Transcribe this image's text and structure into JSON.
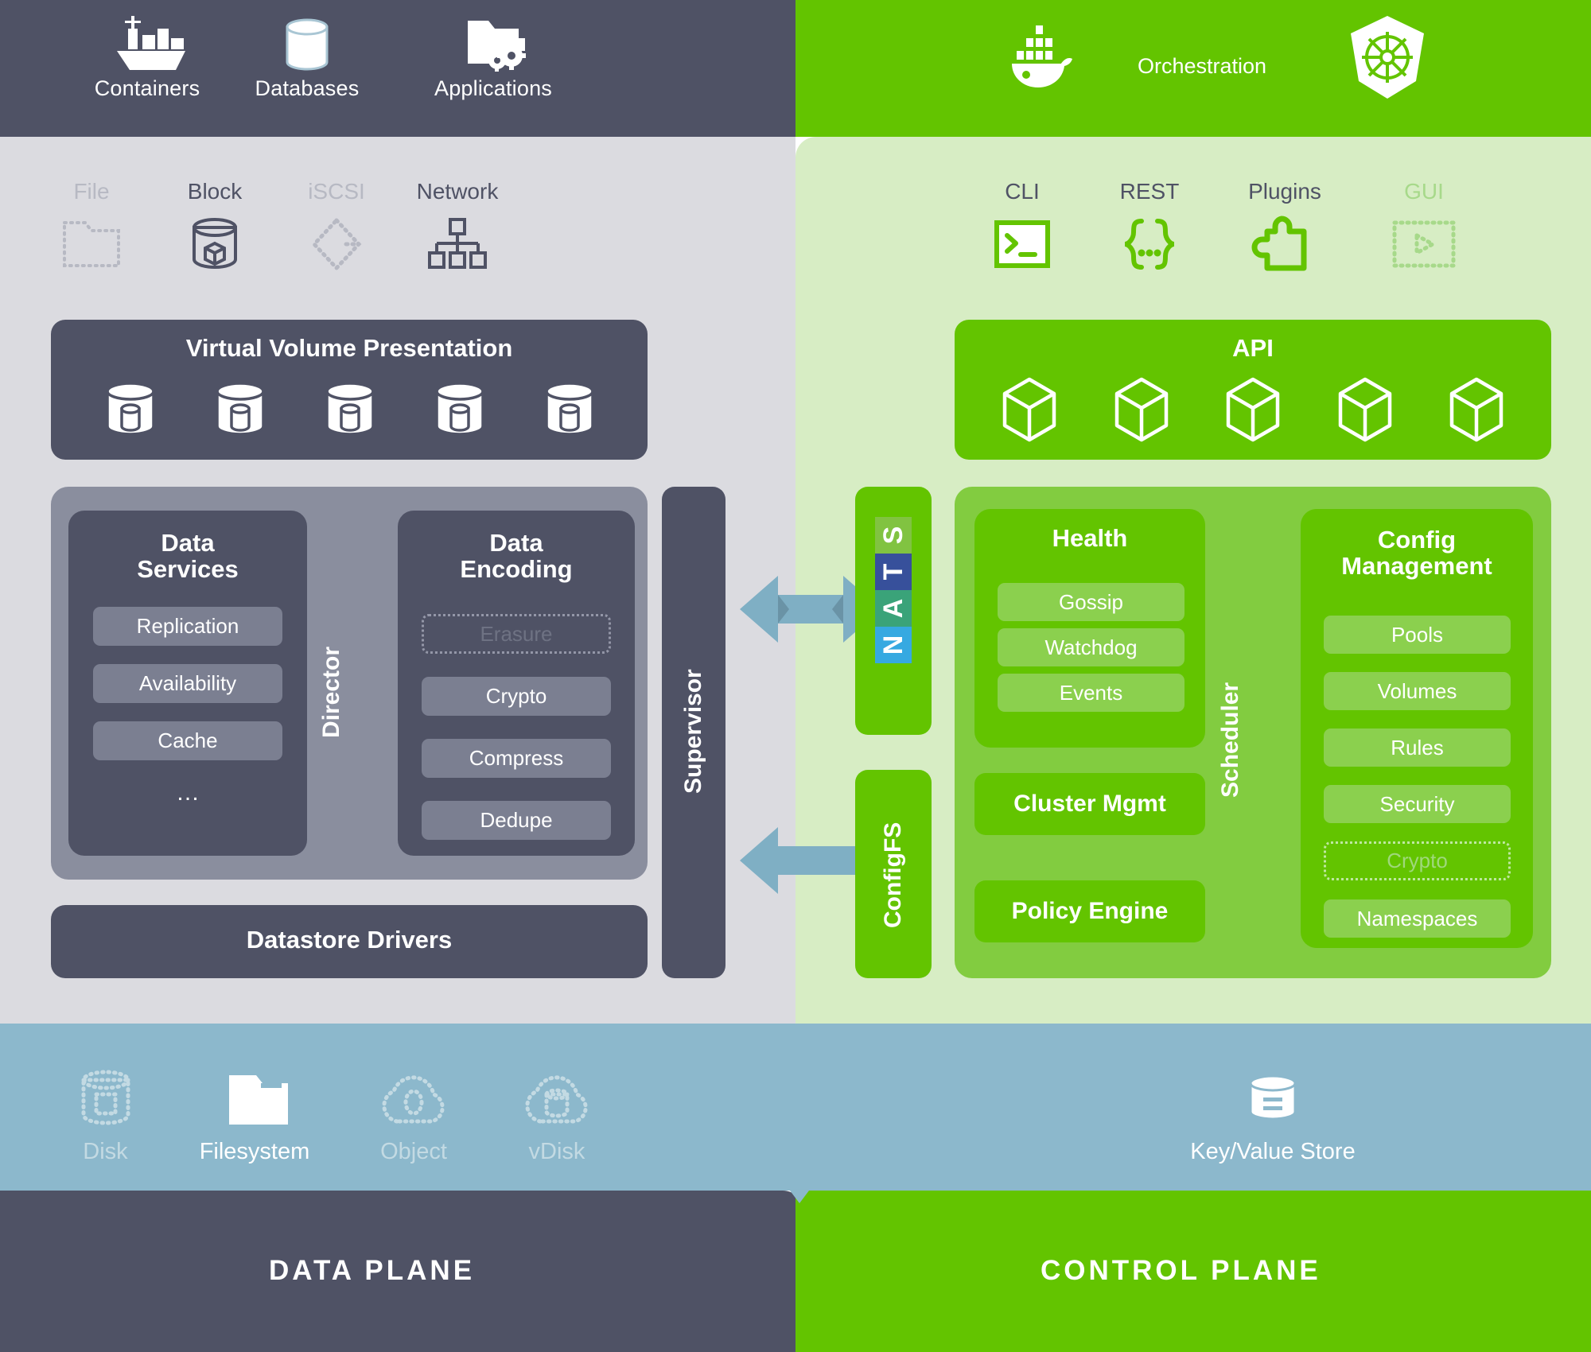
{
  "colors": {
    "data_plane_dark": "#4F5265",
    "control_plane_green": "#63C400",
    "data_plane_bg": "#DBDBE0",
    "control_plane_bg": "#D7EDC4",
    "storage_blue": "#8CB8CC",
    "arrow_blue": "#7FAFC4",
    "nats_s": "#81C341",
    "nats_t": "#37509B",
    "nats_a": "#3AA379",
    "nats_n": "#36A9E1"
  },
  "header": {
    "left_items": [
      {
        "label": "Containers",
        "icon": "container-ship-icon"
      },
      {
        "label": "Databases",
        "icon": "database-cylinder-icon"
      },
      {
        "label": "Applications",
        "icon": "folder-gears-icon"
      }
    ],
    "right_items": [
      {
        "icon": "docker-whale-icon"
      },
      {
        "label": "Orchestration"
      },
      {
        "icon": "kubernetes-helm-icon"
      }
    ]
  },
  "interfaces": {
    "data_plane": [
      {
        "label": "File",
        "icon": "folder-dotted-icon",
        "enabled": false
      },
      {
        "label": "Block",
        "icon": "block-cylinder-icon",
        "enabled": true
      },
      {
        "label": "iSCSI",
        "icon": "iscsi-diamond-icon",
        "enabled": false
      },
      {
        "label": "Network",
        "icon": "network-tree-icon",
        "enabled": true
      }
    ],
    "control_plane": [
      {
        "label": "CLI",
        "icon": "terminal-icon",
        "enabled": true
      },
      {
        "label": "REST",
        "icon": "braces-icon",
        "enabled": true
      },
      {
        "label": "Plugins",
        "icon": "puzzle-icon",
        "enabled": true
      },
      {
        "label": "GUI",
        "icon": "gui-play-icon",
        "enabled": false
      }
    ]
  },
  "virtual_volume": {
    "title": "Virtual Volume Presentation",
    "icon": "volume-cylinder-icon",
    "icon_count": 5
  },
  "api": {
    "title": "API",
    "icon": "cube-icon",
    "icon_count": 5
  },
  "director": {
    "vertical_label": "Director",
    "data_services": {
      "title": "Data\nServices",
      "title_line1": "Data",
      "title_line2": "Services",
      "items": [
        {
          "label": "Replication",
          "enabled": true
        },
        {
          "label": "Availability",
          "enabled": true
        },
        {
          "label": "Cache",
          "enabled": true
        }
      ],
      "ellipsis": "…"
    },
    "data_encoding": {
      "title_line1": "Data",
      "title_line2": "Encoding",
      "items": [
        {
          "label": "Erasure",
          "enabled": false
        },
        {
          "label": "Crypto",
          "enabled": true
        },
        {
          "label": "Compress",
          "enabled": true
        },
        {
          "label": "Dedupe",
          "enabled": true
        }
      ]
    }
  },
  "datastore_drivers": {
    "label": "Datastore Drivers"
  },
  "supervisor": {
    "label": "Supervisor"
  },
  "bus": {
    "nats": {
      "label": "NATS",
      "letters": [
        "S",
        "T",
        "A",
        "N"
      ]
    },
    "configfs": {
      "label": "ConfigFS"
    }
  },
  "scheduler": {
    "vertical_label": "Scheduler",
    "health": {
      "title": "Health",
      "items": [
        {
          "label": "Gossip",
          "enabled": true
        },
        {
          "label": "Watchdog",
          "enabled": true
        },
        {
          "label": "Events",
          "enabled": true
        }
      ]
    },
    "cluster_mgmt": {
      "label": "Cluster Mgmt"
    },
    "policy_engine": {
      "label": "Policy Engine"
    },
    "config_management": {
      "title_line1": "Config",
      "title_line2": "Management",
      "items": [
        {
          "label": "Pools",
          "enabled": true
        },
        {
          "label": "Volumes",
          "enabled": true
        },
        {
          "label": "Rules",
          "enabled": true
        },
        {
          "label": "Security",
          "enabled": true
        },
        {
          "label": "Crypto",
          "enabled": false
        },
        {
          "label": "Namespaces",
          "enabled": true
        }
      ]
    }
  },
  "storage": {
    "left_items": [
      {
        "label": "Disk",
        "icon": "disk-dotted-icon",
        "enabled": false
      },
      {
        "label": "Filesystem",
        "icon": "folder-solid-icon",
        "enabled": true
      },
      {
        "label": "Object",
        "icon": "object-cloud-icon",
        "enabled": false
      },
      {
        "label": "vDisk",
        "icon": "vdisk-cloud-icon",
        "enabled": false
      }
    ],
    "right_item": {
      "label": "Key/Value Store",
      "icon": "kv-store-cylinder-icon",
      "enabled": true
    }
  },
  "footer": {
    "left_label": "DATA PLANE",
    "right_label": "CONTROL PLANE"
  }
}
